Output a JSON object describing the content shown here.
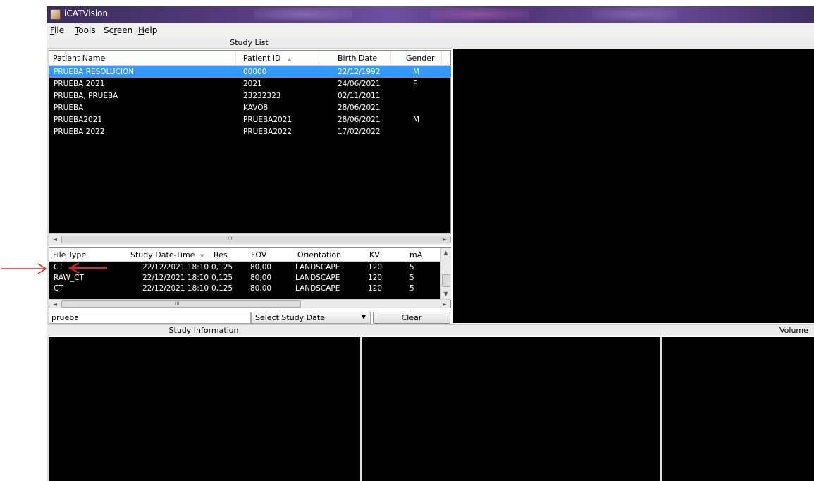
{
  "window": {
    "title": "iCATVision"
  },
  "menu": [
    {
      "label": "File",
      "u": "F",
      "rest": "ile"
    },
    {
      "label": "Tools",
      "u": "T",
      "rest": "ools"
    },
    {
      "label": "Screen",
      "pre": "Sc",
      "u": "r",
      "rest": "een"
    },
    {
      "label": "Help",
      "u": "H",
      "rest": "elp"
    }
  ],
  "study_list": {
    "header": "Study List",
    "columns": [
      "Patient Name",
      "Patient ID",
      "Birth Date",
      "Gender"
    ],
    "sort_indicator": "▲",
    "rows": [
      {
        "name": "PRUEBA RESOLUCION",
        "id": "00000",
        "birth": "22/12/1992",
        "gender": "M",
        "selected": true
      },
      {
        "name": "PRUEBA 2021",
        "id": "2021",
        "birth": "24/06/2021",
        "gender": "F"
      },
      {
        "name": "PRUEBA, PRUEBA",
        "id": "23232323",
        "birth": "02/11/2011",
        "gender": ""
      },
      {
        "name": "PRUEBA",
        "id": "KAVO8",
        "birth": "28/06/2021",
        "gender": ""
      },
      {
        "name": "PRUEBA2021",
        "id": "PRUEBA2021",
        "birth": "28/06/2021",
        "gender": "M"
      },
      {
        "name": "PRUEBA 2022",
        "id": "PRUEBA2022",
        "birth": "17/02/2022",
        "gender": ""
      }
    ]
  },
  "studies": {
    "columns": [
      "File Type",
      "Study Date-Time",
      "Res",
      "FOV",
      "Orientation",
      "KV",
      "mA"
    ],
    "sort_indicator": "▼",
    "rows": [
      {
        "type": "CT",
        "datetime": "22/12/2021 18:10",
        "res": "0,125",
        "fov": "80,00",
        "orientation": "LANDSCAPE",
        "kv": "120",
        "ma": "5"
      },
      {
        "type": "RAW_CT",
        "datetime": "22/12/2021 18:10",
        "res": "0,125",
        "fov": "80,00",
        "orientation": "LANDSCAPE",
        "kv": "120",
        "ma": "5"
      },
      {
        "type": "CT",
        "datetime": "22/12/2021 18:10",
        "res": "0,125",
        "fov": "80,00",
        "orientation": "LANDSCAPE",
        "kv": "120",
        "ma": "5"
      }
    ]
  },
  "search": {
    "value": "prueba",
    "date_select": "Select Study Date",
    "clear_label": "Clear"
  },
  "panels": {
    "study_information": "Study Information",
    "volume": "Volume o"
  },
  "scroll_glyphs": {
    "left": "◄",
    "right": "►",
    "up": "▲",
    "down": "▼",
    "grip": "ııı"
  },
  "colors": {
    "selection": "#3399ff",
    "annotation_arrow": "#e0201c",
    "viewport": "#000000"
  }
}
